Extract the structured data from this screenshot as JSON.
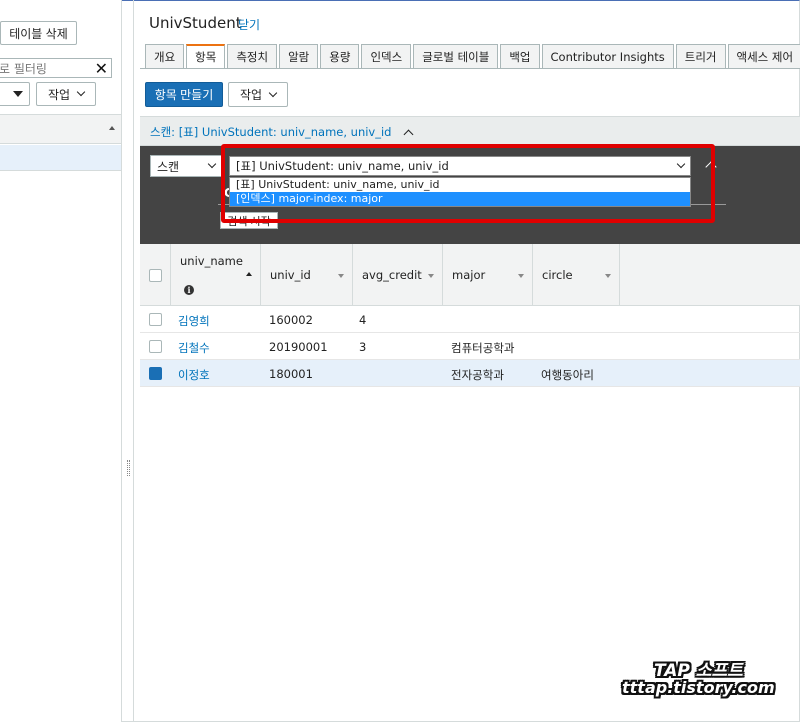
{
  "left_panel": {
    "delete_table_label": "테이블 삭제",
    "filter_value": "로 필터링",
    "clear_filter_glyph": "✕",
    "work_label": "작업"
  },
  "header": {
    "title": "UnivStudent",
    "close_label": "닫기"
  },
  "tabs": [
    {
      "label": "개요"
    },
    {
      "label": "항목"
    },
    {
      "label": "측정치"
    },
    {
      "label": "알람"
    },
    {
      "label": "용량"
    },
    {
      "label": "인덱스"
    },
    {
      "label": "글로벌 테이블"
    },
    {
      "label": "백업"
    },
    {
      "label": "Contributor Insights"
    },
    {
      "label": "트리거"
    },
    {
      "label": "액세스 제어"
    }
  ],
  "active_tab": "항목",
  "toolbar": {
    "create_item_label": "항목 만들기",
    "work_label": "작업"
  },
  "scan_panel": {
    "header_label": "스캔: [표] UnivStudent: univ_name, univ_id",
    "mode_select_value": "스캔",
    "target_select_value": "[표] UnivStudent: univ_name, univ_id",
    "options": [
      "[표] UnivStudent: univ_name, univ_id",
      "[인덱스] major-index: major"
    ],
    "highlighted_option_index": 1,
    "start_search_label": "검색 시작"
  },
  "table": {
    "columns": [
      "univ_name",
      "univ_id",
      "avg_credit",
      "major",
      "circle"
    ],
    "rows": [
      {
        "univ_name": "김영희",
        "univ_id": "160002",
        "avg_credit": "4",
        "major": "",
        "circle": "",
        "selected": false
      },
      {
        "univ_name": "김철수",
        "univ_id": "20190001",
        "avg_credit": "3",
        "major": "컴퓨터공학과",
        "circle": "",
        "selected": false
      },
      {
        "univ_name": "이정호",
        "univ_id": "180001",
        "avg_credit": "",
        "major": "전자공학과",
        "circle": "여행동아리",
        "selected": true
      }
    ]
  },
  "watermark": {
    "line1": "TAP 소프트",
    "line2": "tttap.tistory.com"
  },
  "colors": {
    "primary_button": "#1a6fb5",
    "link": "#0073bb",
    "active_tab_accent": "#ec7211",
    "annotation_box": "#e00000",
    "dropdown_highlight": "#1e90ff"
  }
}
